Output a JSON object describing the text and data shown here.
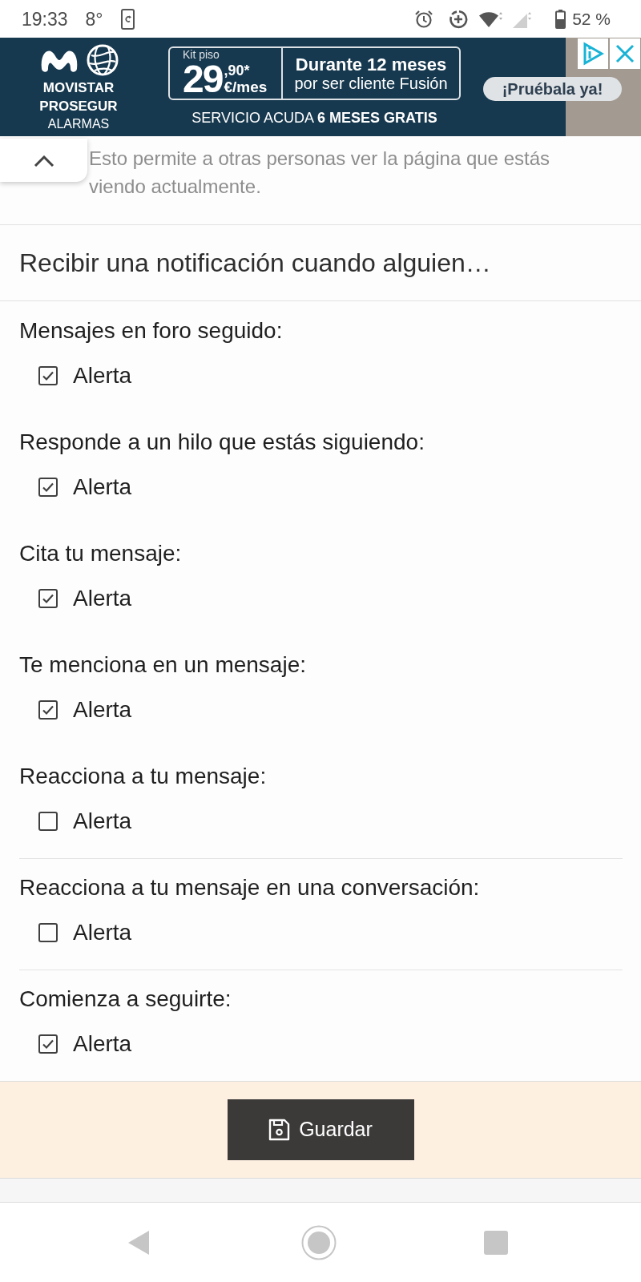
{
  "status_bar": {
    "time": "19:33",
    "temperature": "8°",
    "battery": "52 %"
  },
  "ad": {
    "brand_names": [
      "MOVISTAR",
      "PROSEGUR"
    ],
    "brand_category": "ALARMAS",
    "offer_caption": "Kit piso",
    "price": "29",
    "price_decimals": ",90*",
    "price_unit": "€/mes",
    "headline": "Durante 12 meses",
    "subline": "por ser cliente Fusión",
    "tagline": "SERVICIO ACUDA **6 MESES GRATIS**",
    "cta": "¡Pruébala ya!"
  },
  "share_note": "Esto permite a otras personas ver la página que estás viendo actualmente.",
  "section_title": "Recibir una notificación cuando alguien…",
  "options": [
    {
      "label": "Mensajes en foro seguido:",
      "checkbox": "Alerta",
      "checked": true,
      "divider_above": false
    },
    {
      "label": "Responde a un hilo que estás siguiendo:",
      "checkbox": "Alerta",
      "checked": true,
      "divider_above": false
    },
    {
      "label": "Cita tu mensaje:",
      "checkbox": "Alerta",
      "checked": true,
      "divider_above": false
    },
    {
      "label": "Te menciona en un mensaje:",
      "checkbox": "Alerta",
      "checked": true,
      "divider_above": false
    },
    {
      "label": "Reacciona a tu mensaje:",
      "checkbox": "Alerta",
      "checked": false,
      "divider_above": false
    },
    {
      "label": "Reacciona a tu mensaje en una conversación:",
      "checkbox": "Alerta",
      "checked": false,
      "divider_above": true
    },
    {
      "label": "Comienza a seguirte:",
      "checkbox": "Alerta",
      "checked": true,
      "divider_above": true
    }
  ],
  "save_button": {
    "label": "Guardar"
  }
}
